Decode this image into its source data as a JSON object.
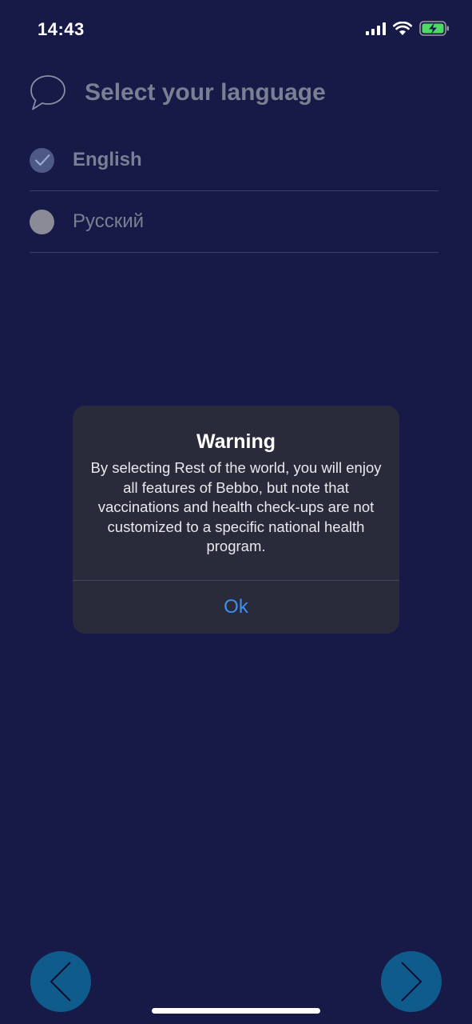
{
  "status_bar": {
    "time": "14:43"
  },
  "header": {
    "title": "Select your language"
  },
  "languages": [
    {
      "label": "English",
      "selected": true
    },
    {
      "label": "Русский",
      "selected": false
    }
  ],
  "dialog": {
    "title": "Warning",
    "message": "By selecting Rest of the world, you will enjoy all features of Bebbo, but note that vaccinations and health check-ups are not customized to a specific national health program.",
    "ok_label": "Ok"
  },
  "colors": {
    "background": "#171946",
    "dialog_bg": "#2a2b3a",
    "ok_text": "#3f8ff2",
    "nav_button": "#0f5b8c"
  },
  "icons": {
    "header": "chat-bubble-icon",
    "prev": "chevron-left-icon",
    "next": "chevron-right-icon",
    "check": "checkmark-icon"
  }
}
